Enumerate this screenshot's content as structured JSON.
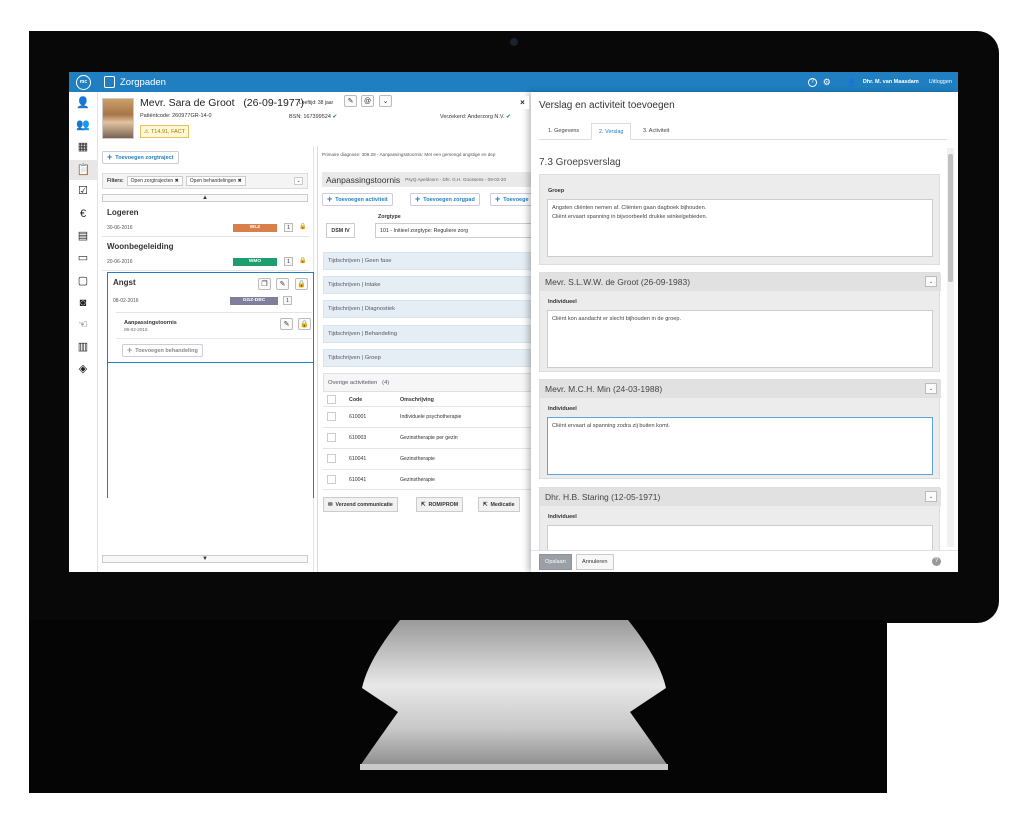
{
  "app": {
    "title": "Zorgpaden",
    "logo": "mc",
    "help": "?",
    "user": "Dhr. M. van Maasdam",
    "logout": "Uitloggen"
  },
  "nav": [
    "add-person-icon",
    "group-icon",
    "calendar-icon",
    "clipboard-icon",
    "checklist-icon",
    "euro-icon",
    "chart-icon",
    "invoice-icon",
    "folder-icon",
    "media-icon",
    "hand-icon",
    "report-icon",
    "signpost-icon"
  ],
  "patient": {
    "name": "Mevr. Sara de Groot",
    "dob": "(26-09-1977)",
    "age": "Leeftijd: 38 jaar",
    "code": "Patiëntcode: 260977GR-14-0",
    "warning": "T14.91, FACT",
    "bsn": "BSN: 167399524",
    "verzekerd": "Verzekerd: Anderzorg N.V."
  },
  "left": {
    "add_label": "Toevoegen zorgtraject",
    "filters_label": "Filters:",
    "filter_chips": [
      "Open zorgtrajecten ✖",
      "Open behandelingen ✖"
    ],
    "up_arrow": "▲",
    "down_arrow": "▼",
    "trajects": [
      {
        "title": "Logeren",
        "date": "30-06-2016",
        "badge": "WLZ",
        "badge_color": "#d9804a",
        "count": "1"
      },
      {
        "title": "Woonbegeleiding",
        "date": "20-06-2016",
        "badge": "WMO",
        "badge_color": "#1e9e6e",
        "count": "1"
      },
      {
        "title": "Angst",
        "date": "08-02-2016",
        "badge": "GGZ-DBC",
        "badge_color": "#7f7f9c",
        "count": "1"
      }
    ],
    "treatment": {
      "title": "Aanpassingstoornis",
      "date": "08-02-2016"
    },
    "add_treatment": "Toevoegen behandeling"
  },
  "middle": {
    "diagnosis": "Primaire diagnose: 309.28 - Aanpassingsstoornis: Met een gemengd angstige en dep",
    "title": "Aanpassingstoornis",
    "subtitle": "PsyQ Apeldoorn - Dhr. G.H. Goossens - 08-02-20",
    "buttons": [
      "Toevoegen activiteit",
      "Toevoegen zorgpad",
      "Toevoege"
    ],
    "zorgtype_label": "Zorgtype",
    "dsm": "DSM IV",
    "zorgtype_value": "101 - Initieel zorgtype: Reguliere zorg",
    "tijdschrijven": [
      "Tijdschrijven | Geen fase",
      "Tijdschrijven | Intake",
      "Tijdschrijven | Diagnostiek",
      "Tijdschrijven | Behandeling",
      "Tijdschrijven | Groep"
    ],
    "overige": "Overige activiteiten",
    "overige_count": "(4)",
    "col_code": "Code",
    "col_desc": "Omschrijving",
    "rows": [
      {
        "code": "610001",
        "desc": "Individuele psychotherapie"
      },
      {
        "code": "610003",
        "desc": "Gezinstherapie per gezin"
      },
      {
        "code": "610041",
        "desc": "Gezinstherapie"
      },
      {
        "code": "610041",
        "desc": "Gezinstherapie"
      }
    ],
    "bottom_buttons": [
      "Verzend communicatie",
      "ROM/PROM",
      "Medicatie"
    ]
  },
  "panel": {
    "close": "×",
    "title": "Verslag en activiteit toevoegen",
    "tabs": [
      "1. Gegevens",
      "2. Verslag",
      "3. Activiteit"
    ],
    "section": "7.3  Groepsverslag",
    "groep_label": "Groep",
    "groep_text": "Angsten cliënten nemen af. Cliënten gaan dagboek bijhouden.\nCliënt ervaart spanning in bijvoorbeeld drukke winkelgebieden.",
    "individueel_label": "Individueel",
    "persons": [
      {
        "name": "Mevr. S.L.W.W. de Groot (26-09-1983)",
        "text": "Cliënt kon aandacht er slecht bijhouden in de groep."
      },
      {
        "name": "Mevr. M.C.H. Min (24-03-1988)",
        "text": "Cliënt ervaart al spanning zodra zij buiten komt."
      },
      {
        "name": "Dhr. H.B. Staring (12-05-1971)",
        "text": ""
      }
    ],
    "save": "Opslaan",
    "cancel": "Annuleren",
    "help": "?"
  }
}
